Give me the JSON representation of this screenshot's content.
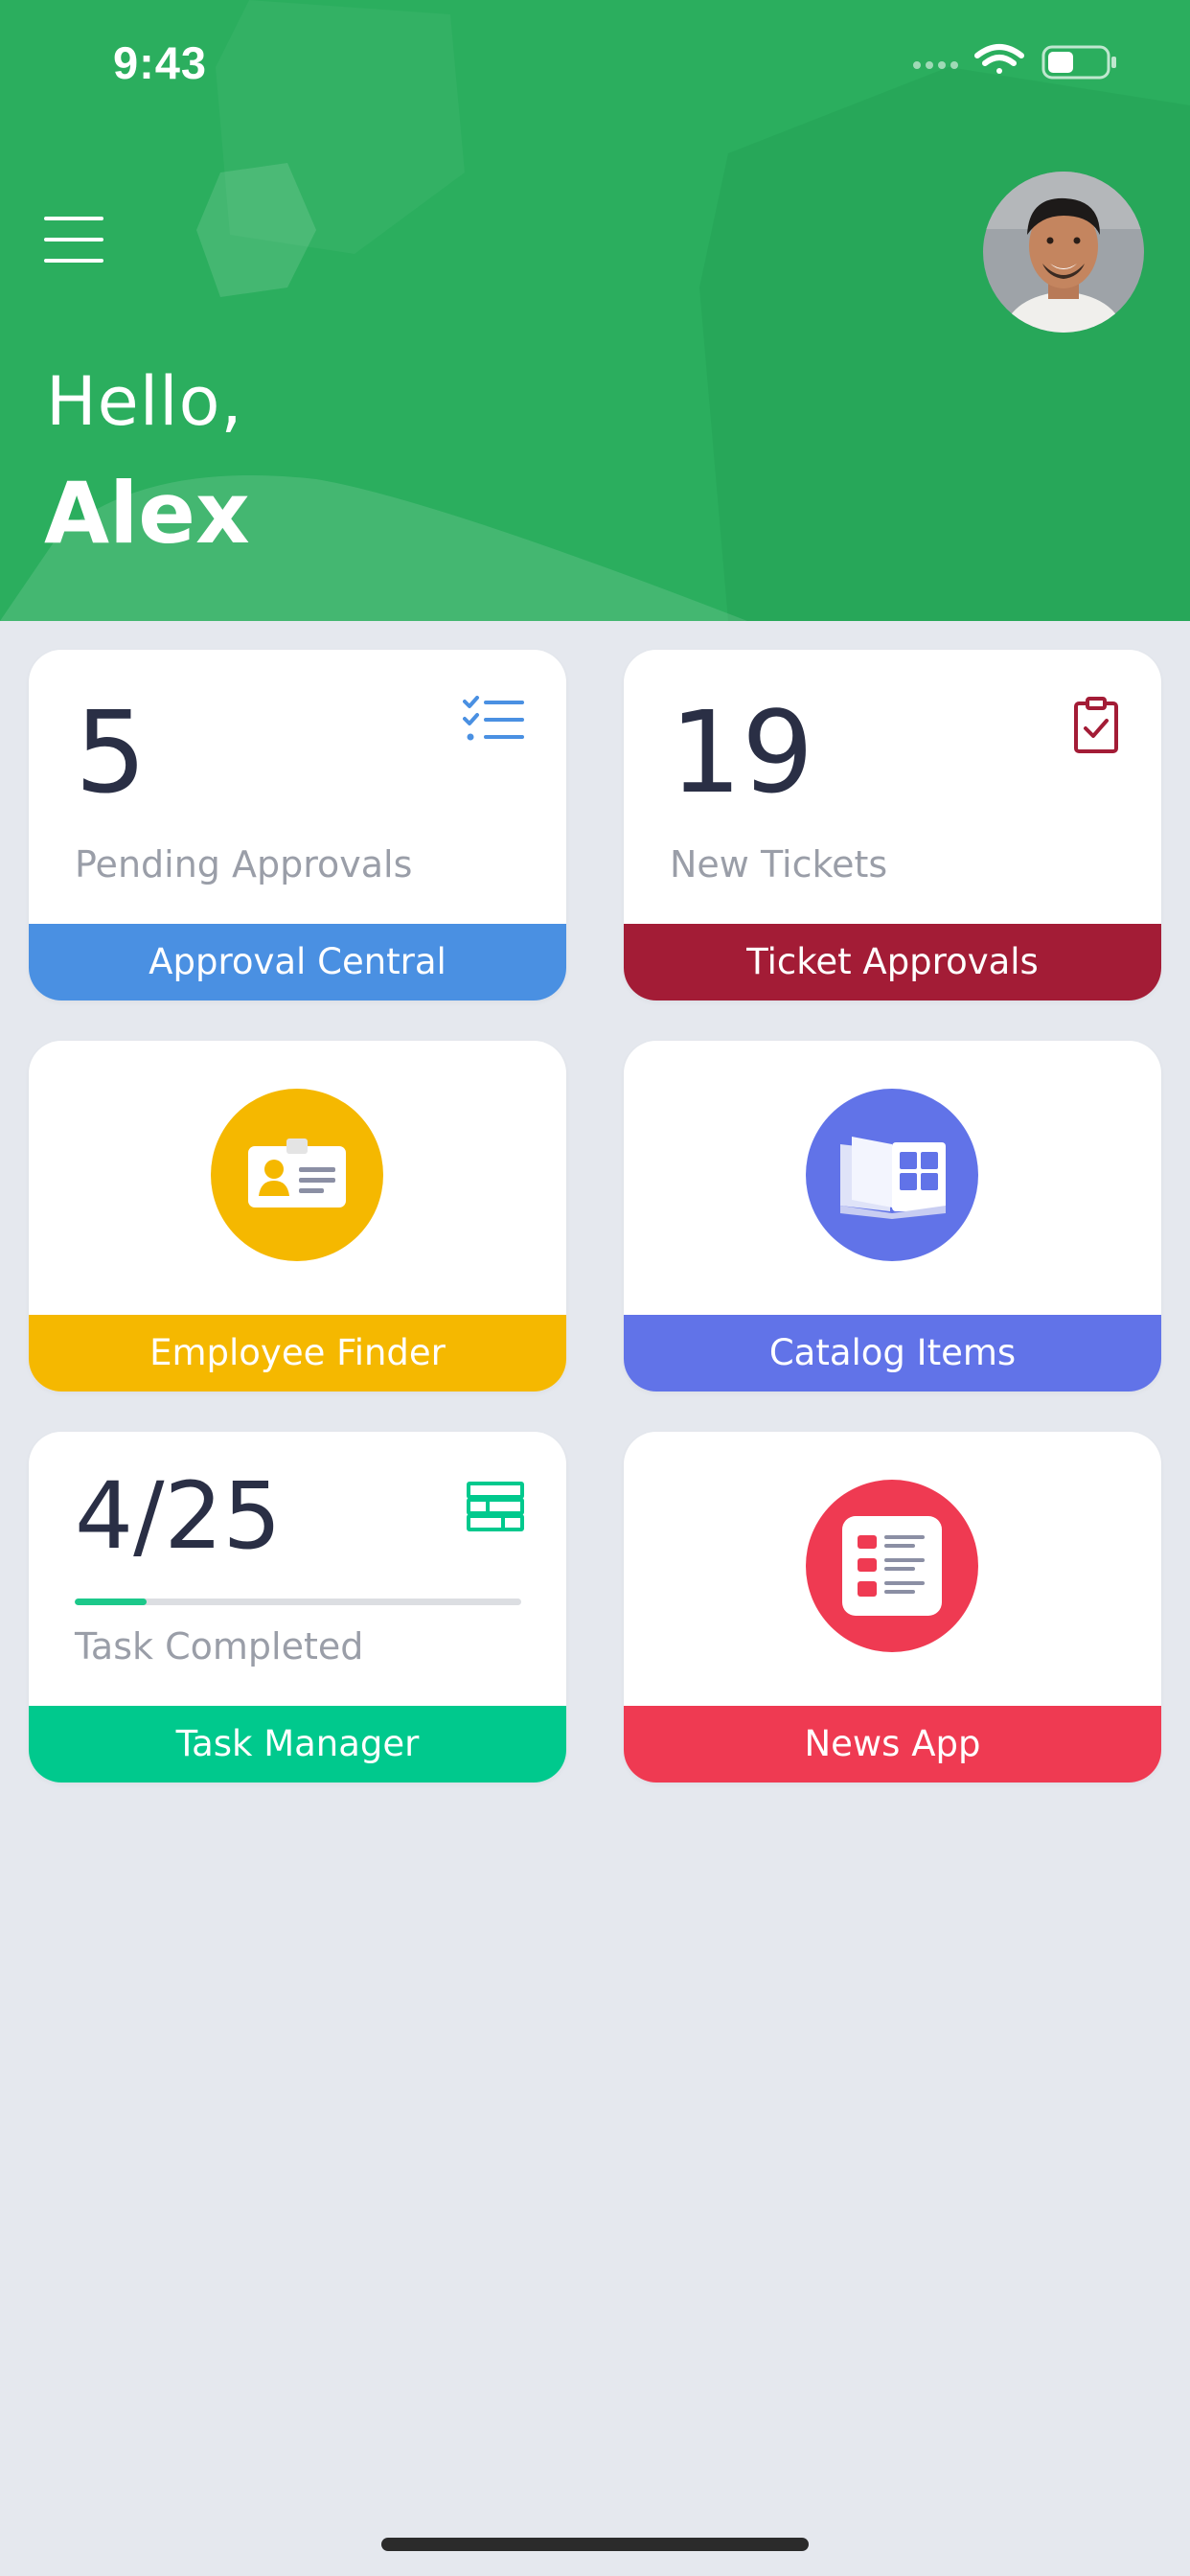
{
  "status_bar": {
    "time": "9:43"
  },
  "colors": {
    "header_bg": "#2bae5e",
    "page_bg": "#e5e8ee",
    "approval_blue": "#4a90e2",
    "ticket_red": "#a31c36",
    "employee_yellow": "#f5b800",
    "catalog_indigo": "#6173e8",
    "task_green": "#00c98d",
    "news_red": "#ef3a52"
  },
  "header": {
    "greeting": "Hello,",
    "user_name": "Alex",
    "menu_icon": "hamburger-menu-icon",
    "avatar_icon": "user-avatar"
  },
  "cards": {
    "approvals": {
      "count": "5",
      "caption": "Pending Approvals",
      "footer": "Approval Central",
      "icon": "checklist-icon"
    },
    "tickets": {
      "count": "19",
      "caption": "New Tickets",
      "footer": "Ticket Approvals",
      "icon": "clipboard-check-icon"
    },
    "employee": {
      "footer": "Employee Finder",
      "icon": "id-badge-icon"
    },
    "catalog": {
      "footer": "Catalog Items",
      "icon": "catalog-book-icon"
    },
    "tasks": {
      "count": "4/25",
      "caption": "Task Completed",
      "footer": "Task Manager",
      "icon": "table-grid-icon",
      "progress": 0.16
    },
    "news": {
      "footer": "News App",
      "icon": "news-list-icon"
    }
  }
}
